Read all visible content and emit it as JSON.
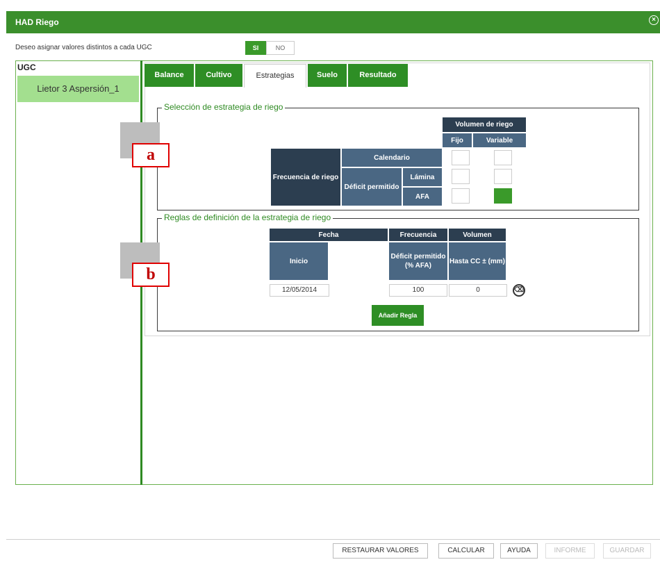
{
  "window": {
    "title": "HAD Riego",
    "close_icon": "close-icon"
  },
  "assign": {
    "label": "Deseo asignar valores distintos a cada UGC",
    "yes": "SI",
    "no": "NO"
  },
  "ugc": {
    "title": "UGC",
    "items": [
      {
        "label": "Lietor 3 Aspersión_1"
      }
    ]
  },
  "tabs": [
    {
      "label": "Balance",
      "active": false
    },
    {
      "label": "Cultivo",
      "active": false
    },
    {
      "label": "Estrategias",
      "active": true
    },
    {
      "label": "Suelo",
      "active": false
    },
    {
      "label": "Resultado",
      "active": false
    }
  ],
  "strategy": {
    "legend": "Selección de estrategia de riego",
    "volumen_header": "Volumen de riego",
    "fijo": "Fijo",
    "variable": "Variable",
    "frecuencia": "Frecuencia de riego",
    "calendario": "Calendario",
    "deficit": "Déficit permitido",
    "lamina": "Lámina",
    "afa": "AFA",
    "selected": {
      "row": "AFA",
      "column": "Variable"
    }
  },
  "rules": {
    "legend": "Reglas de definición de la estrategia de riego",
    "fecha": "Fecha",
    "frecuencia": "Frecuencia",
    "volumen": "Volumen",
    "inicio": "Inicio",
    "deficit": "Déficit permitido (% AFA)",
    "hasta": "Hasta CC ± (mm)",
    "row": {
      "fecha": "12/05/2014",
      "deficit": "100",
      "volumen": "0"
    },
    "add_button": "Añadir Regla"
  },
  "annotations": {
    "a": "a",
    "b": "b"
  },
  "footer": {
    "restaurar": "RESTAURAR VALORES",
    "calcular": "CALCULAR",
    "ayuda": "AYUDA",
    "informe": "INFORME",
    "guardar": "GUARDAR"
  },
  "colors": {
    "brand_green": "#3b8f2c",
    "header_dark": "#2c3e50",
    "header_blue": "#4a6783"
  }
}
